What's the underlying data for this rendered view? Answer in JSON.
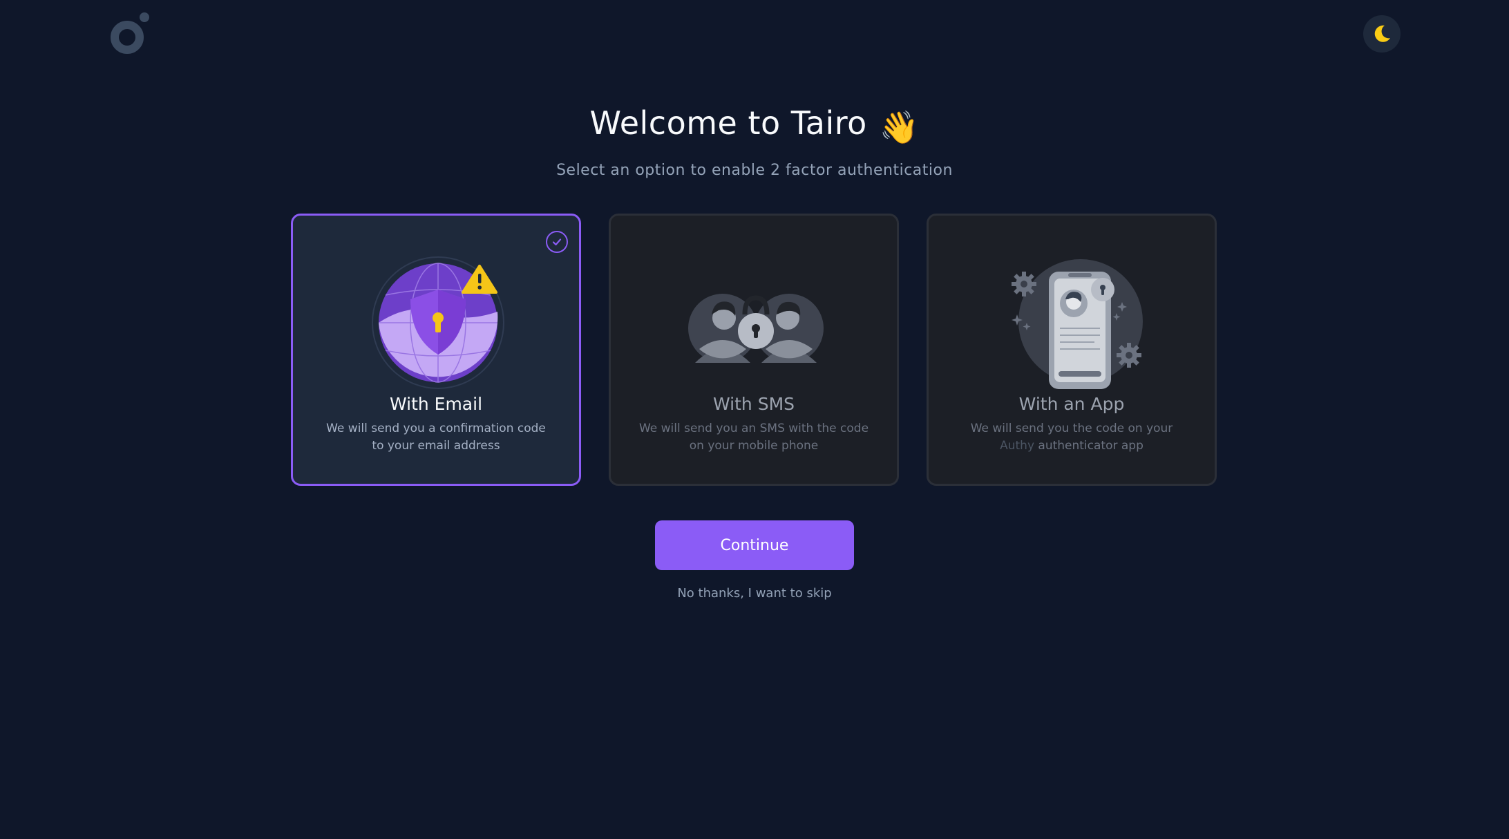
{
  "header": {
    "logo_icon": "tairo-logo-icon",
    "theme_toggle_icon": "moon-icon"
  },
  "hero": {
    "title": "Welcome to Tairo",
    "emoji": "👋",
    "subtitle": "Select an option to enable 2 factor authentication"
  },
  "options": [
    {
      "title": "With Email",
      "description": "We will send you a confirmation code to your email address",
      "selected": true,
      "illustration": "shield-globe-icon"
    },
    {
      "title": "With SMS",
      "description": "We will send you an SMS with the code on your mobile phone",
      "selected": false,
      "illustration": "users-lock-icon"
    },
    {
      "title": "With an App",
      "description_prefix": "We will send you the code on your",
      "description_brand": "Authy",
      "description_suffix": "authenticator app",
      "selected": false,
      "illustration": "phone-app-icon"
    }
  ],
  "actions": {
    "continue_label": "Continue",
    "skip_label": "No thanks, I want to skip"
  },
  "colors": {
    "background": "#0f172a",
    "accent": "#8b5cf6",
    "moon": "#facc15"
  }
}
